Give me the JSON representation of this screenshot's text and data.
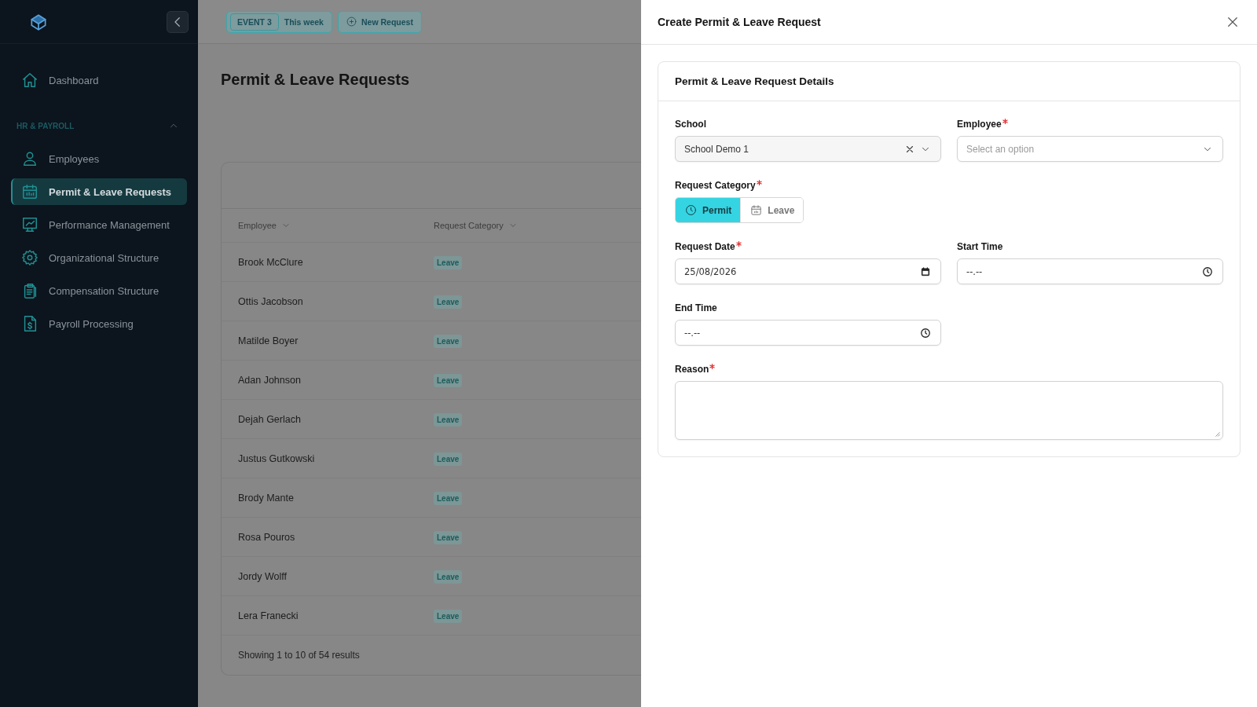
{
  "sidebar": {
    "items": [
      {
        "label": "Dashboard",
        "selected": false
      }
    ],
    "section": {
      "title": "HR & PAYROLL",
      "expanded": true,
      "items": [
        {
          "label": "Employees",
          "selected": false
        },
        {
          "label": "Permit & Leave Requests",
          "selected": true
        },
        {
          "label": "Performance Management",
          "selected": false
        },
        {
          "label": "Organizational Structure",
          "selected": false
        },
        {
          "label": "Compensation Structure",
          "selected": false
        },
        {
          "label": "Payroll Processing",
          "selected": false
        }
      ]
    }
  },
  "topbar": {
    "event_badge": "EVENT 3",
    "period": "This week",
    "new_request": "New Request"
  },
  "page_title": "Permit & Leave Requests",
  "table": {
    "columns": [
      {
        "label": "Employee",
        "sortable": true
      },
      {
        "label": "Request Category",
        "sortable": true
      }
    ],
    "rows": [
      {
        "employee": "Brook McClure",
        "category": "Leave"
      },
      {
        "employee": "Ottis Jacobson",
        "category": "Leave"
      },
      {
        "employee": "Matilde Boyer",
        "category": "Leave"
      },
      {
        "employee": "Adan Johnson",
        "category": "Leave"
      },
      {
        "employee": "Dejah Gerlach",
        "category": "Leave"
      },
      {
        "employee": "Justus Gutkowski",
        "category": "Leave"
      },
      {
        "employee": "Brody Mante",
        "category": "Leave"
      },
      {
        "employee": "Rosa Pouros",
        "category": "Leave"
      },
      {
        "employee": "Jordy Wolff",
        "category": "Leave"
      },
      {
        "employee": "Lera Franecki",
        "category": "Leave"
      }
    ],
    "footer": "Showing 1 to 10 of 54 results"
  },
  "drawer": {
    "title": "Create Permit & Leave Request",
    "card_title": "Permit & Leave Request Details",
    "fields": [
      {
        "kind": "select",
        "label": "School",
        "required": false,
        "value": "School Demo 1",
        "clearable": true
      },
      {
        "kind": "select",
        "label": "Employee",
        "required": true,
        "placeholder": "Select an option",
        "clearable": false
      },
      {
        "kind": "segmented",
        "label": "Request Category",
        "required": true,
        "options": [
          {
            "label": "Permit",
            "selected": true
          },
          {
            "label": "Leave",
            "selected": false
          }
        ]
      },
      {
        "kind": "date",
        "label": "Request Date",
        "required": true,
        "value": "25/08/2026"
      },
      {
        "kind": "time",
        "label": "Start Time",
        "required": false,
        "value": "--.--"
      },
      {
        "kind": "time",
        "label": "End Time",
        "required": false,
        "value": "--.--"
      },
      {
        "kind": "textarea",
        "label": "Reason",
        "required": true
      }
    ]
  }
}
